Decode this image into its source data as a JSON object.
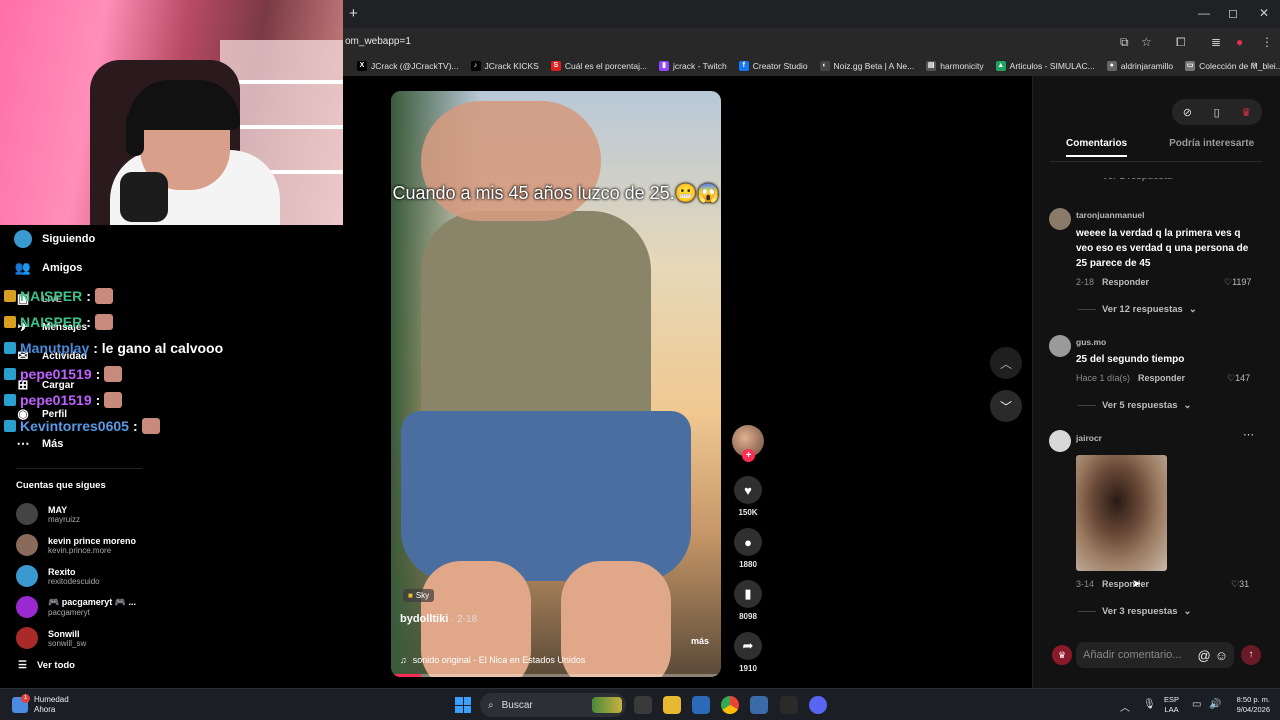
{
  "browser": {
    "new_tab": "+",
    "url": "om_webapp=1",
    "window_controls": [
      "—",
      "◻",
      "✕"
    ],
    "bookmarks": [
      {
        "label": "JCrack (@JCrackTV)...",
        "icon": "x-icon",
        "color": "#000000",
        "glyph": "X"
      },
      {
        "label": "JCrack KICKS",
        "icon": "tiktok-icon",
        "color": "#000000",
        "glyph": "♪"
      },
      {
        "label": "Cuál es el porcentaj...",
        "icon": "s-icon",
        "color": "#e02020",
        "glyph": "S"
      },
      {
        "label": "jcrack - Twitch",
        "icon": "twitch-icon",
        "color": "#9146ff",
        "glyph": "▮"
      },
      {
        "label": "Creator Studio",
        "icon": "facebook-icon",
        "color": "#1877f2",
        "glyph": "f"
      },
      {
        "label": "Noiz.gg Beta | A Ne...",
        "icon": "noiz-icon",
        "color": "#444444",
        "glyph": "◐"
      },
      {
        "label": "harmonicity",
        "icon": "folder-icon",
        "color": "#555555",
        "glyph": "▤"
      },
      {
        "label": "Articulos - SIMULAC...",
        "icon": "drive-icon",
        "color": "#1fa463",
        "glyph": "▲"
      },
      {
        "label": "aldrinjaramillo",
        "icon": "globe-icon",
        "color": "#666666",
        "glyph": "●"
      },
      {
        "label": "Colección de M_blei...",
        "icon": "doc-icon",
        "color": "#777777",
        "glyph": "▭"
      }
    ]
  },
  "nav": {
    "following": "Siguiendo",
    "friends": "Amigos",
    "live": "LIVE",
    "messages": "Mensajes",
    "activity": "Actividad",
    "upload": "Cargar",
    "profile": "Perfil",
    "more": "Más",
    "following_title": "Cuentas que sigues",
    "see_all": "Ver todo"
  },
  "accounts": [
    {
      "name": "MAY",
      "handle": "mayruizz",
      "color": "#444444"
    },
    {
      "name": "kevin prince moreno",
      "handle": "kevin.prince.more",
      "color": "#8a6a5a"
    },
    {
      "name": "Rexito",
      "handle": "rexitodescuido",
      "color": "#3a9ad0"
    },
    {
      "name": "🎮 pacgameryt 🎮 ...",
      "handle": "pacgameryt",
      "color": "#9a2ad0"
    },
    {
      "name": "Sonwill",
      "handle": "sonwill_sw",
      "color": "#aa2a2a"
    }
  ],
  "chat": [
    {
      "user": "NAISPER",
      "text": ":",
      "color": "#3ec28a"
    },
    {
      "user": "NAISPER",
      "text": ":",
      "color": "#3ec28a"
    },
    {
      "user": "Manutplay",
      "text": ": le gano al calvooo",
      "color": "#4a8ad8"
    },
    {
      "user": "pepe01519",
      "text": ":",
      "color": "#c060ff"
    },
    {
      "user": "pepe01519",
      "text": ":",
      "color": "#c060ff"
    },
    {
      "user": "Kevintorres0605",
      "text": ":",
      "color": "#5a9ae8"
    }
  ],
  "video": {
    "caption": "Cuando a mis 45 años luzco de 25.😬😱",
    "tag": "Sky",
    "author": "bydolltiki",
    "date": " · 2-18",
    "more": "más",
    "sound": "sonido original - El Nica en Estados Unidos",
    "progress": 0.09
  },
  "actions": {
    "likes": "150K",
    "comments": "1880",
    "saves": "8098",
    "shares": "1910"
  },
  "panel": {
    "tab_comments": "Comentarios",
    "tab_related": "Podría interesarte",
    "prev_replies": "Ver 1 respuesta"
  },
  "comments": [
    {
      "user": "taronjuanmanuel",
      "text": "weeee la verdad q la primera ves q veo eso es verdad q una persona de 25 parece de 45",
      "date": "2-18",
      "reply": "Responder",
      "likes": "1197",
      "more": "Ver 12 respuestas",
      "avatar_color": "#8a7a6a"
    },
    {
      "user": "gus.mo",
      "text": "25 del segundo tiempo",
      "date": "Hace 1 día(s)",
      "reply": "Responder",
      "likes": "147",
      "more": "Ver 5 respuestas",
      "avatar_color": "#9a9a9a"
    },
    {
      "user": "jairocr",
      "text": "",
      "date": "3-14",
      "reply": "Responder",
      "likes": "31",
      "more": "Ver 3 respuestas",
      "avatar_color": "#d8d8d8"
    }
  ],
  "comment_input": {
    "placeholder": "Añadir comentario..."
  },
  "taskbar": {
    "weather_title": "Humedad",
    "weather_sub": "Ahora",
    "search": "Buscar",
    "lang1": "ESP",
    "lang2": "LAA",
    "time": "8:50 p. m.",
    "date": "9/04/2026"
  }
}
